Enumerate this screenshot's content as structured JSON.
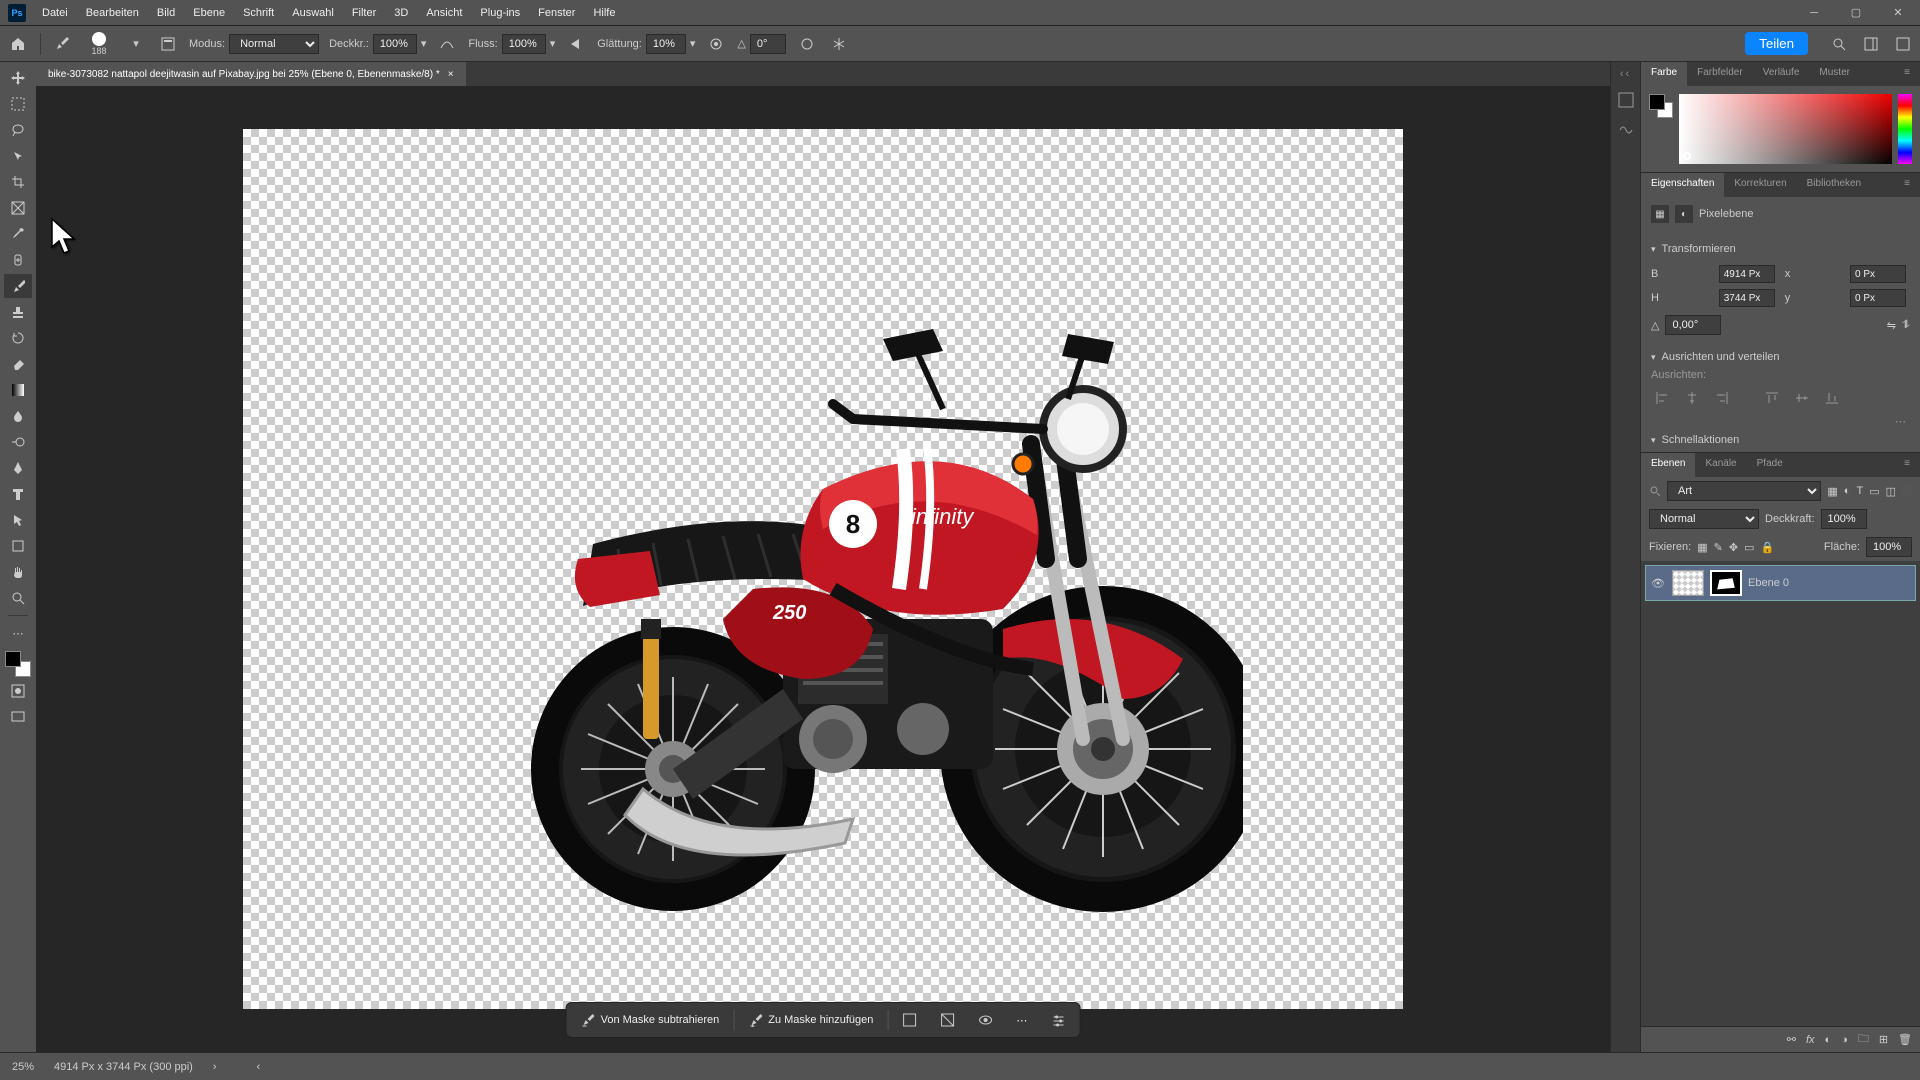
{
  "menu": [
    "Datei",
    "Bearbeiten",
    "Bild",
    "Ebene",
    "Schrift",
    "Auswahl",
    "Filter",
    "3D",
    "Ansicht",
    "Plug-ins",
    "Fenster",
    "Hilfe"
  ],
  "optbar": {
    "brush_size": "188",
    "modus_label": "Modus:",
    "modus_value": "Normal",
    "deckkr_label": "Deckkr.:",
    "deckkr_value": "100%",
    "fluss_label": "Fluss:",
    "fluss_value": "100%",
    "glaettung_label": "Glättung:",
    "glaettung_value": "10%",
    "angle_label": "△",
    "angle_value": "0°",
    "share": "Teilen"
  },
  "doc_tab": "bike-3073082 nattapol deejitwasin auf Pixabay.jpg bei 25% (Ebene 0, Ebenenmaske/8) *",
  "mask_toolbar": {
    "subtract": "Von Maske subtrahieren",
    "add": "Zu Maske hinzufügen"
  },
  "panels": {
    "color_tabs": [
      "Farbe",
      "Farbfelder",
      "Verläufe",
      "Muster"
    ],
    "props_tabs": [
      "Eigenschaften",
      "Korrekturen",
      "Bibliotheken"
    ],
    "props_type": "Pixelebene",
    "transform_head": "Transformieren",
    "align_head": "Ausrichten und verteilen",
    "align_label": "Ausrichten:",
    "quick_head": "Schnellaktionen",
    "w_label": "B",
    "w_val": "4914 Px",
    "h_label": "H",
    "h_val": "3744 Px",
    "x_label": "x",
    "x_val": "0 Px",
    "y_label": "y",
    "y_val": "0 Px",
    "angle_val": "0,00°",
    "layers_tabs": [
      "Ebenen",
      "Kanäle",
      "Pfade"
    ],
    "layer_kind": "Art",
    "blend_mode": "Normal",
    "opacity_label": "Deckkraft:",
    "opacity_val": "100%",
    "lock_label": "Fixieren:",
    "fill_label": "Fläche:",
    "fill_val": "100%",
    "layer_name": "Ebene 0"
  },
  "status": {
    "zoom": "25%",
    "dims": "4914 Px x 3744 Px (300 ppi)"
  }
}
